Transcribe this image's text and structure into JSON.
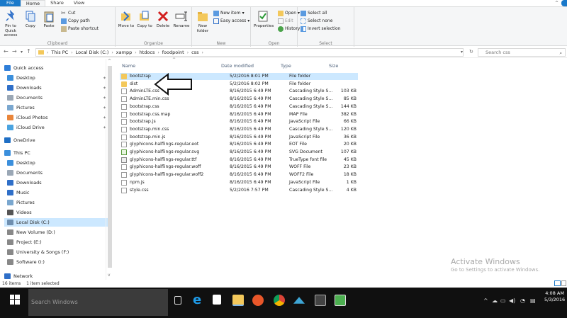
{
  "ribbon_tabs": [
    "File",
    "Home",
    "Share",
    "View"
  ],
  "ribbon": {
    "clipboard": {
      "label": "Clipboard",
      "pin": "Pin to Quick access",
      "copy": "Copy",
      "paste": "Paste",
      "cut": "Cut",
      "copy_path": "Copy path",
      "paste_shortcut": "Paste shortcut"
    },
    "organize": {
      "label": "Organize",
      "move_to": "Move to",
      "copy_to": "Copy to",
      "delete": "Delete",
      "rename": "Rename"
    },
    "new": {
      "label": "New",
      "new_folder": "New folder",
      "new_item": "New item",
      "easy_access": "Easy access"
    },
    "open": {
      "label": "Open",
      "properties": "Properties",
      "open": "Open",
      "edit": "Edit",
      "history": "History"
    },
    "select": {
      "label": "Select",
      "select_all": "Select all",
      "select_none": "Select none",
      "invert": "Invert selection"
    }
  },
  "address": {
    "path": [
      "This PC",
      "Local Disk (C:)",
      "xampp",
      "htdocs",
      "foodpoint",
      "css"
    ],
    "search_placeholder": "Search css"
  },
  "nav": {
    "items": [
      {
        "label": "Quick access",
        "icon": "star-icon",
        "color": "#2f7ed8",
        "indent": 0,
        "pinned": false
      },
      {
        "label": "Desktop",
        "icon": "desktop-icon",
        "color": "#3b8fdc",
        "indent": 1,
        "pinned": true
      },
      {
        "label": "Downloads",
        "icon": "download-icon",
        "color": "#2f6fc8",
        "indent": 1,
        "pinned": true
      },
      {
        "label": "Documents",
        "icon": "document-icon",
        "color": "#9aa7b5",
        "indent": 1,
        "pinned": true
      },
      {
        "label": "Pictures",
        "icon": "pictures-icon",
        "color": "#7aa7cf",
        "indent": 1,
        "pinned": true
      },
      {
        "label": "iCloud Photos",
        "icon": "icloud-photos-icon",
        "color": "#e9853a",
        "indent": 1,
        "pinned": true
      },
      {
        "label": "iCloud Drive",
        "icon": "icloud-drive-icon",
        "color": "#4aa3e0",
        "indent": 1,
        "pinned": true
      },
      {
        "label": "OneDrive",
        "icon": "onedrive-icon",
        "color": "#1f6fc5",
        "indent": 0,
        "pinned": false
      },
      {
        "label": "This PC",
        "icon": "pc-icon",
        "color": "#3b8fdc",
        "indent": 0,
        "pinned": false
      },
      {
        "label": "Desktop",
        "icon": "desktop-icon",
        "color": "#3b8fdc",
        "indent": 1,
        "pinned": false
      },
      {
        "label": "Documents",
        "icon": "document-icon",
        "color": "#9aa7b5",
        "indent": 1,
        "pinned": false
      },
      {
        "label": "Downloads",
        "icon": "download-icon",
        "color": "#2f6fc8",
        "indent": 1,
        "pinned": false
      },
      {
        "label": "Music",
        "icon": "music-icon",
        "color": "#2f6fc8",
        "indent": 1,
        "pinned": false
      },
      {
        "label": "Pictures",
        "icon": "pictures-icon",
        "color": "#7aa7cf",
        "indent": 1,
        "pinned": false
      },
      {
        "label": "Videos",
        "icon": "videos-icon",
        "color": "#555",
        "indent": 1,
        "pinned": false
      },
      {
        "label": "Local Disk (C:)",
        "icon": "drive-icon",
        "color": "#6f8fb0",
        "indent": 1,
        "pinned": false,
        "selected": true
      },
      {
        "label": "New Volume (D:)",
        "icon": "drive-icon",
        "color": "#888",
        "indent": 1,
        "pinned": false
      },
      {
        "label": "Project (E:)",
        "icon": "drive-icon",
        "color": "#888",
        "indent": 1,
        "pinned": false
      },
      {
        "label": "University & Songs (F:)",
        "icon": "drive-icon",
        "color": "#888",
        "indent": 1,
        "pinned": false
      },
      {
        "label": "Software (I:)",
        "icon": "drive-icon",
        "color": "#888",
        "indent": 1,
        "pinned": false
      },
      {
        "label": "Network",
        "icon": "network-icon",
        "color": "#2f6fc8",
        "indent": 0,
        "pinned": false
      }
    ]
  },
  "columns": [
    "Name",
    "Date modified",
    "Type",
    "Size"
  ],
  "files": [
    {
      "name": "bootstrap",
      "date": "5/2/2016 8:01 PM",
      "type": "File folder",
      "size": "",
      "kind": "folder",
      "selected": true
    },
    {
      "name": "dist",
      "date": "5/2/2016 8:02 PM",
      "type": "File folder",
      "size": "",
      "kind": "folder"
    },
    {
      "name": "AdminLTE.css",
      "date": "8/16/2015 6:49 PM",
      "type": "Cascading Style S...",
      "size": "103 KB",
      "kind": "file"
    },
    {
      "name": "AdminLTE.min.css",
      "date": "8/16/2015 6:49 PM",
      "type": "Cascading Style S...",
      "size": "85 KB",
      "kind": "file"
    },
    {
      "name": "bootstrap.css",
      "date": "8/16/2015 6:49 PM",
      "type": "Cascading Style S...",
      "size": "144 KB",
      "kind": "file"
    },
    {
      "name": "bootstrap.css.map",
      "date": "8/16/2015 6:49 PM",
      "type": "MAP File",
      "size": "382 KB",
      "kind": "file"
    },
    {
      "name": "bootstrap.js",
      "date": "8/16/2015 6:49 PM",
      "type": "JavaScript File",
      "size": "66 KB",
      "kind": "file"
    },
    {
      "name": "bootstrap.min.css",
      "date": "8/16/2015 6:49 PM",
      "type": "Cascading Style S...",
      "size": "120 KB",
      "kind": "file"
    },
    {
      "name": "bootstrap.min.js",
      "date": "8/16/2015 6:49 PM",
      "type": "JavaScript File",
      "size": "36 KB",
      "kind": "file"
    },
    {
      "name": "glyphicons-halflings-regular.eot",
      "date": "8/16/2015 6:49 PM",
      "type": "EOT File",
      "size": "20 KB",
      "kind": "file"
    },
    {
      "name": "glyphicons-halflings-regular.svg",
      "date": "8/16/2015 6:49 PM",
      "type": "SVG Document",
      "size": "107 KB",
      "kind": "svg"
    },
    {
      "name": "glyphicons-halflings-regular.ttf",
      "date": "8/16/2015 6:49 PM",
      "type": "TrueType font file",
      "size": "45 KB",
      "kind": "ttf"
    },
    {
      "name": "glyphicons-halflings-regular.woff",
      "date": "8/16/2015 6:49 PM",
      "type": "WOFF File",
      "size": "23 KB",
      "kind": "file"
    },
    {
      "name": "glyphicons-halflings-regular.woff2",
      "date": "8/16/2015 6:49 PM",
      "type": "WOFF2 File",
      "size": "18 KB",
      "kind": "file"
    },
    {
      "name": "npm.js",
      "date": "8/16/2015 6:49 PM",
      "type": "JavaScript File",
      "size": "1 KB",
      "kind": "file"
    },
    {
      "name": "style.css",
      "date": "5/2/2016 7:57 PM",
      "type": "Cascading Style S...",
      "size": "4 KB",
      "kind": "file"
    }
  ],
  "status": {
    "count": "16 items",
    "selected": "1 item selected"
  },
  "watermark": {
    "title": "Activate Windows",
    "subtitle": "Go to Settings to activate Windows."
  },
  "taskbar": {
    "search_placeholder": "Search Windows",
    "time": "4:08 AM",
    "date": "5/3/2016"
  }
}
